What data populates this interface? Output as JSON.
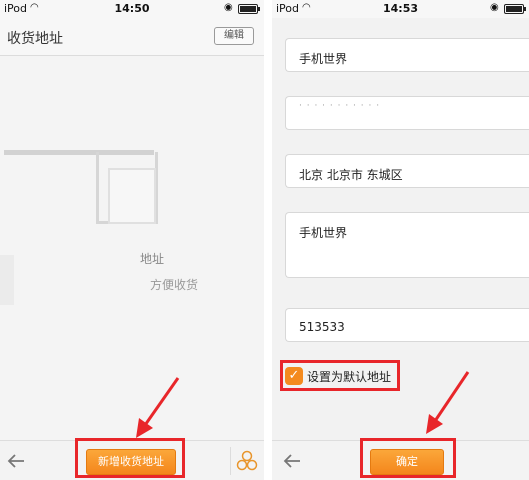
{
  "left": {
    "status": {
      "carrier": "iPod",
      "time": "14:50"
    },
    "title": "收货地址",
    "edit_label": "编辑",
    "empty_text_1": "地址",
    "empty_text_2": "方便收货",
    "add_button": "新增收货地址"
  },
  "right": {
    "status": {
      "carrier": "iPod",
      "time": "14:53"
    },
    "fields": {
      "name": "手机世界",
      "phone": "· · · · · · · · · · ·",
      "region": "北京 北京市 东城区",
      "address": "手机世界",
      "zip": "513533"
    },
    "default_label": "设置为默认地址",
    "confirm_button": "确定"
  },
  "colors": {
    "accent_orange": "#f4861c",
    "annotation_red": "#e8262a"
  }
}
